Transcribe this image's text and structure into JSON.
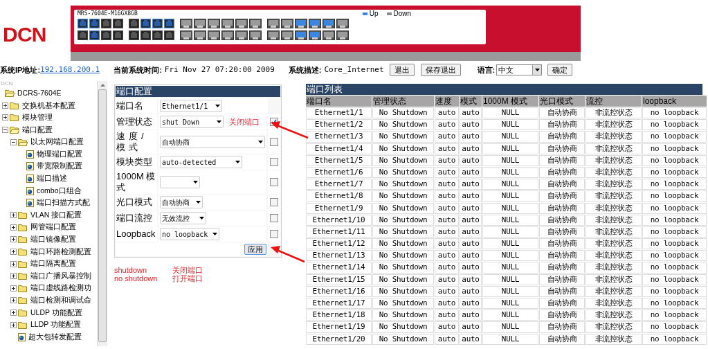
{
  "logo": "DCN",
  "front_panel": {
    "model": "MRS-7604E-M16GX8GB",
    "legend": [
      {
        "label": "Up",
        "color": "#3a86e0"
      },
      {
        "label": "Down",
        "color": "#8a8a8a"
      }
    ],
    "rows": [
      [
        {
          "kind": "rj45",
          "up": true
        },
        {
          "kind": "rj45",
          "up": true
        },
        {
          "kind": "rj45",
          "up": false
        },
        {
          "kind": "rj45",
          "up": false
        },
        {
          "kind": "rj45",
          "up": false
        },
        {
          "kind": "rj45",
          "up": true
        },
        {
          "kind": "rj45",
          "up": true
        },
        {
          "kind": "rj45",
          "up": true
        },
        {
          "kind": "sfp",
          "up": false
        },
        {
          "kind": "sfp",
          "up": false
        },
        {
          "kind": "sfp",
          "up": false
        },
        {
          "kind": "sfp",
          "up": false
        },
        {
          "kind": "sfp",
          "up": false
        },
        {
          "kind": "sfp",
          "up": false
        },
        {
          "kind": "sfp",
          "up": false
        },
        {
          "kind": "sfp",
          "up": false
        },
        {
          "kind": "sfp",
          "up": true
        },
        {
          "kind": "sfp",
          "up": true
        },
        {
          "kind": "sfp",
          "up": true
        },
        {
          "kind": "sfp",
          "up": false
        }
      ],
      [
        {
          "kind": "rj45",
          "up": false
        },
        {
          "kind": "rj45",
          "up": true
        },
        {
          "kind": "rj45",
          "up": false
        },
        {
          "kind": "rj45",
          "up": false
        },
        {
          "kind": "rj45",
          "up": false
        },
        {
          "kind": "rj45",
          "up": false
        },
        {
          "kind": "rj45",
          "up": false
        },
        {
          "kind": "rj45",
          "up": false
        },
        {
          "kind": "sfp",
          "up": false
        },
        {
          "kind": "sfp",
          "up": false
        },
        {
          "kind": "sfp",
          "up": false
        },
        {
          "kind": "sfp",
          "up": false
        },
        {
          "kind": "sfp",
          "up": false
        },
        {
          "kind": "sfp",
          "up": false
        },
        {
          "kind": "sfp",
          "up": false
        },
        {
          "kind": "sfp",
          "up": false
        },
        {
          "kind": "sfp",
          "up": true
        },
        {
          "kind": "sfp",
          "up": true
        },
        {
          "kind": "sfp",
          "up": false
        },
        {
          "kind": "sfp",
          "up": false
        }
      ]
    ]
  },
  "info_bar": {
    "ip_label": "系统IP地址:",
    "ip": "192.168.200.1",
    "time_label": "当前系统时间:",
    "time": "Fri Nov 27 07:20:00 2009",
    "desc_label": "系统描述:",
    "desc": "Core_Internet",
    "buttons": [
      "退出",
      "保存退出"
    ],
    "language_label": "语言:",
    "language": "中文",
    "confirm": "确定"
  },
  "sidebar": {
    "caption": "DCN",
    "tree": [
      {
        "label": "DCRS-7604E",
        "kind": "root",
        "expanded": true,
        "children": [
          {
            "label": "交换机基本配置",
            "kind": "folder",
            "expanded": false
          },
          {
            "label": "模块管理",
            "kind": "folder",
            "expanded": false
          },
          {
            "label": "端口配置",
            "kind": "folder",
            "expanded": true,
            "children": [
              {
                "label": "以太网端口配置",
                "kind": "folder",
                "expanded": true,
                "children": [
                  {
                    "label": "物理端口配置",
                    "kind": "page"
                  },
                  {
                    "label": "带宽限制配置",
                    "kind": "page"
                  },
                  {
                    "label": "端口描述",
                    "kind": "page"
                  },
                  {
                    "label": "combo口组合",
                    "kind": "page"
                  },
                  {
                    "label": "端口扫描方式配",
                    "kind": "page"
                  }
                ]
              },
              {
                "label": "VLAN 接口配置",
                "kind": "folder",
                "expanded": false
              },
              {
                "label": "网管端口配置",
                "kind": "folder",
                "expanded": false
              },
              {
                "label": "端口镜像配置",
                "kind": "folder",
                "expanded": false
              },
              {
                "label": "端口环路检测配置",
                "kind": "folder",
                "expanded": false
              },
              {
                "label": "端口隔离配置",
                "kind": "folder",
                "expanded": false
              },
              {
                "label": "端口广播风暴控制",
                "kind": "folder",
                "expanded": false
              },
              {
                "label": "端口虚线路检测功",
                "kind": "folder",
                "expanded": false
              },
              {
                "label": "端口检测和调试命",
                "kind": "folder",
                "expanded": false
              },
              {
                "label": "ULDP 功能配置",
                "kind": "folder",
                "expanded": false
              },
              {
                "label": "LLDP 功能配置",
                "kind": "folder",
                "expanded": false
              },
              {
                "label": "超大包转发配置",
                "kind": "page"
              }
            ]
          }
        ]
      }
    ]
  },
  "port_config": {
    "title": "端口配置",
    "fields": [
      {
        "label": "端口名",
        "value": "Ethernet1/1"
      },
      {
        "label": "管理状态",
        "value": "shut Down",
        "note": "关闭端口",
        "checked": true
      },
      {
        "label": "速度/模式",
        "value": "自动协商",
        "checked": false
      },
      {
        "label": "模块类型",
        "value": "auto-detected",
        "checked": false
      },
      {
        "label": "1000M 模式",
        "checked": false
      },
      {
        "label": "光口模式",
        "value": "自动协商",
        "checked": false
      },
      {
        "label": "端口流控",
        "value": "无效流控",
        "checked": false
      },
      {
        "label": "Loopback",
        "value": "no loopback",
        "checked": false
      }
    ],
    "apply": "应用"
  },
  "notes": [
    {
      "term": "shutdown",
      "meaning": "关闭端口"
    },
    {
      "term": "no shutdown",
      "meaning": "打开端口"
    }
  ],
  "port_list": {
    "title": "端口列表",
    "columns": [
      "端口名",
      "管理状态",
      "速度",
      "模式",
      "1000M 模式",
      "光口模式",
      "流控",
      "loopback"
    ],
    "rows": [
      [
        "Ethernet1/1",
        "No Shutdown",
        "auto",
        "auto",
        "NULL",
        "自动协商",
        "非流控状态",
        "no loopback"
      ],
      [
        "Ethernet1/2",
        "No Shutdown",
        "auto",
        "auto",
        "NULL",
        "自动协商",
        "非流控状态",
        "no loopback"
      ],
      [
        "Ethernet1/3",
        "No Shutdown",
        "auto",
        "auto",
        "NULL",
        "自动协商",
        "非流控状态",
        "no loopback"
      ],
      [
        "Ethernet1/4",
        "No Shutdown",
        "auto",
        "auto",
        "NULL",
        "自动协商",
        "非流控状态",
        "no loopback"
      ],
      [
        "Ethernet1/5",
        "No Shutdown",
        "auto",
        "auto",
        "NULL",
        "自动协商",
        "非流控状态",
        "no loopback"
      ],
      [
        "Ethernet1/6",
        "No Shutdown",
        "auto",
        "auto",
        "NULL",
        "自动协商",
        "非流控状态",
        "no loopback"
      ],
      [
        "Ethernet1/7",
        "No Shutdown",
        "auto",
        "auto",
        "NULL",
        "自动协商",
        "非流控状态",
        "no loopback"
      ],
      [
        "Ethernet1/8",
        "No Shutdown",
        "auto",
        "auto",
        "NULL",
        "自动协商",
        "非流控状态",
        "no loopback"
      ],
      [
        "Ethernet1/9",
        "No Shutdown",
        "auto",
        "auto",
        "NULL",
        "自动协商",
        "非流控状态",
        "no loopback"
      ],
      [
        "Ethernet1/10",
        "No Shutdown",
        "auto",
        "auto",
        "NULL",
        "自动协商",
        "非流控状态",
        "no loopback"
      ],
      [
        "Ethernet1/11",
        "No Shutdown",
        "auto",
        "auto",
        "NULL",
        "自动协商",
        "非流控状态",
        "no loopback"
      ],
      [
        "Ethernet1/12",
        "No Shutdown",
        "auto",
        "auto",
        "NULL",
        "自动协商",
        "非流控状态",
        "no loopback"
      ],
      [
        "Ethernet1/13",
        "No Shutdown",
        "auto",
        "auto",
        "NULL",
        "自动协商",
        "非流控状态",
        "no loopback"
      ],
      [
        "Ethernet1/14",
        "No Shutdown",
        "auto",
        "auto",
        "NULL",
        "自动协商",
        "非流控状态",
        "no loopback"
      ],
      [
        "Ethernet1/15",
        "No Shutdown",
        "auto",
        "auto",
        "NULL",
        "自动协商",
        "非流控状态",
        "no loopback"
      ],
      [
        "Ethernet1/16",
        "No Shutdown",
        "auto",
        "auto",
        "NULL",
        "自动协商",
        "非流控状态",
        "no loopback"
      ],
      [
        "Ethernet1/17",
        "No Shutdown",
        "auto",
        "auto",
        "NULL",
        "自动协商",
        "非流控状态",
        "no loopback"
      ],
      [
        "Ethernet1/18",
        "No Shutdown",
        "auto",
        "auto",
        "NULL",
        "自动协商",
        "非流控状态",
        "no loopback"
      ],
      [
        "Ethernet1/19",
        "No Shutdown",
        "auto",
        "auto",
        "NULL",
        "自动协商",
        "非流控状态",
        "no loopback"
      ],
      [
        "Ethernet1/20",
        "No Shutdown",
        "auto",
        "auto",
        "NULL",
        "自动协商",
        "非流控状态",
        "no loopback"
      ]
    ]
  }
}
